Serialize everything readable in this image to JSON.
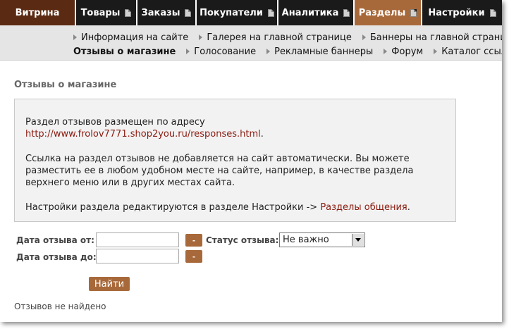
{
  "topnav": {
    "items": [
      {
        "label": "Витрина"
      },
      {
        "label": "Товары"
      },
      {
        "label": "Заказы"
      },
      {
        "label": "Покупатели"
      },
      {
        "label": "Аналитика"
      },
      {
        "label": "Разделы"
      },
      {
        "label": "Настройки"
      }
    ]
  },
  "subnav": {
    "row1": [
      "Информация на сайте",
      "Галерея на главной странице",
      "Баннеры на главной страниц"
    ],
    "row2": [
      "Отзывы о магазине",
      "Голосование",
      "Рекламные баннеры",
      "Форум",
      "Каталог ссылок"
    ]
  },
  "page": {
    "title": "Отзывы о магазине"
  },
  "info": {
    "p1_text": "Раздел отзывов размещен по адресу ",
    "p1_link": "http://www.frolov7771.shop2you.ru/responses.html",
    "p1_end": ".",
    "p2": "Ссылка на раздел отзывов не добавляется на сайт автоматически. Вы можете разместить ее в любом удобном месте на сайте, например, в качестве раздела верхнего меню или в других местах сайта.",
    "p3_text": "Настройки раздела редактируются в разделе Настройки -> ",
    "p3_link": "Разделы общения",
    "p3_end": "."
  },
  "filters": {
    "date_from_label": "Дата отзыва от:",
    "date_to_label": "Дата отзыва до:",
    "date_from_value": "",
    "date_to_value": "",
    "mini_button": "-",
    "status_label": "Статус отзыва:",
    "status_value": "Не важно"
  },
  "actions": {
    "find_label": "Найти"
  },
  "results": {
    "empty_text": "Отзывов не найдено"
  },
  "colors": {
    "brand": "#5a2a12",
    "active": "#a8693a",
    "link": "#8a1a0f"
  }
}
